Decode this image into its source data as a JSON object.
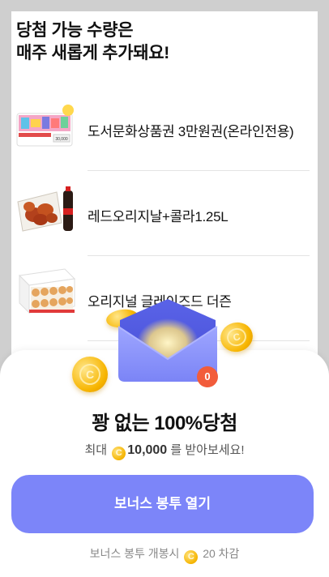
{
  "headline": {
    "line1": "당첨 가능 수량은",
    "line2": "매주 새롭게 추가돼요!"
  },
  "prizes": [
    {
      "label": "도서문화상품권 3만원권(온라인전용)",
      "icon": "gift-card-thumbnail",
      "card_value": "30,000"
    },
    {
      "label": "레드오리지날+콜라1.25L",
      "icon": "fried-chicken-cola-thumbnail"
    },
    {
      "label": "오리지널 글레이즈드 더즌",
      "icon": "donut-box-thumbnail"
    }
  ],
  "envelope": {
    "badge_count": "0",
    "icon": "envelope-icon"
  },
  "sheet": {
    "title": "꽝 없는 100%당첨",
    "sub_prefix": "최대",
    "coin_symbol": "C",
    "sub_amount": "10,000",
    "sub_suffix": "를 받아보세요!",
    "button_label": "보너스 봉투 열기",
    "footer_prefix": "보너스 봉투 개봉시",
    "footer_suffix": "20 차감"
  },
  "colors": {
    "accent": "#7c85f9",
    "coin": "#f7b500",
    "badge": "#f25c3b"
  }
}
